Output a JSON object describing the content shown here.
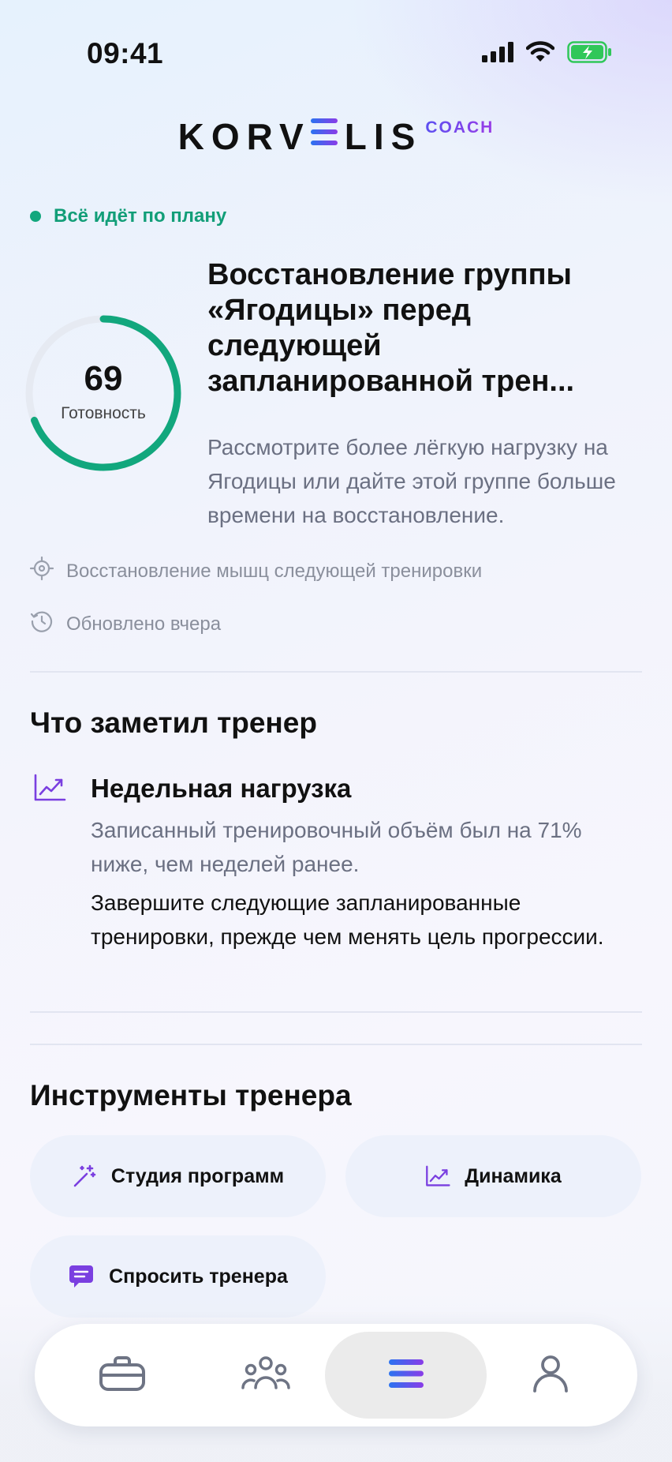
{
  "status_bar": {
    "time": "09:41"
  },
  "brand": {
    "name_left": "KORV",
    "name_right": "LIS",
    "suffix": "COACH"
  },
  "plan_status": "Всё идёт по плану",
  "readiness": {
    "value": 69,
    "label": "Готовность",
    "fraction": 0.69,
    "ring_color": "#12a77d"
  },
  "recommendation": {
    "title": "Восстановление группы «Ягодицы» перед следующей запланированной трен...",
    "body": "Рассмотрите более лёгкую нагрузку на Ягодицы или дайте этой группе больше времени на восстановление."
  },
  "meta": {
    "target": "Восстановление мышц следующей тренировки",
    "updated": "Обновлено вчера"
  },
  "coach_notes": {
    "title": "Что заметил тренер",
    "item": {
      "title": "Недельная нагрузка",
      "body": "Записанный тренировочный объём был на 71% ниже, чем неделей ранее.",
      "action": "Завершите следующие запланированные тренировки, прежде чем менять цель прогрессии."
    }
  },
  "tools": {
    "title": "Инструменты тренера",
    "program_studio": "Студия программ",
    "dynamics": "Динамика",
    "ask_coach": "Спросить тренера"
  },
  "nav": [
    "workouts-icon",
    "community-icon",
    "coach-icon",
    "profile-icon"
  ],
  "colors": {
    "accent": "#7a3fe0",
    "success": "#12a77d",
    "text_muted": "#6b7082"
  }
}
